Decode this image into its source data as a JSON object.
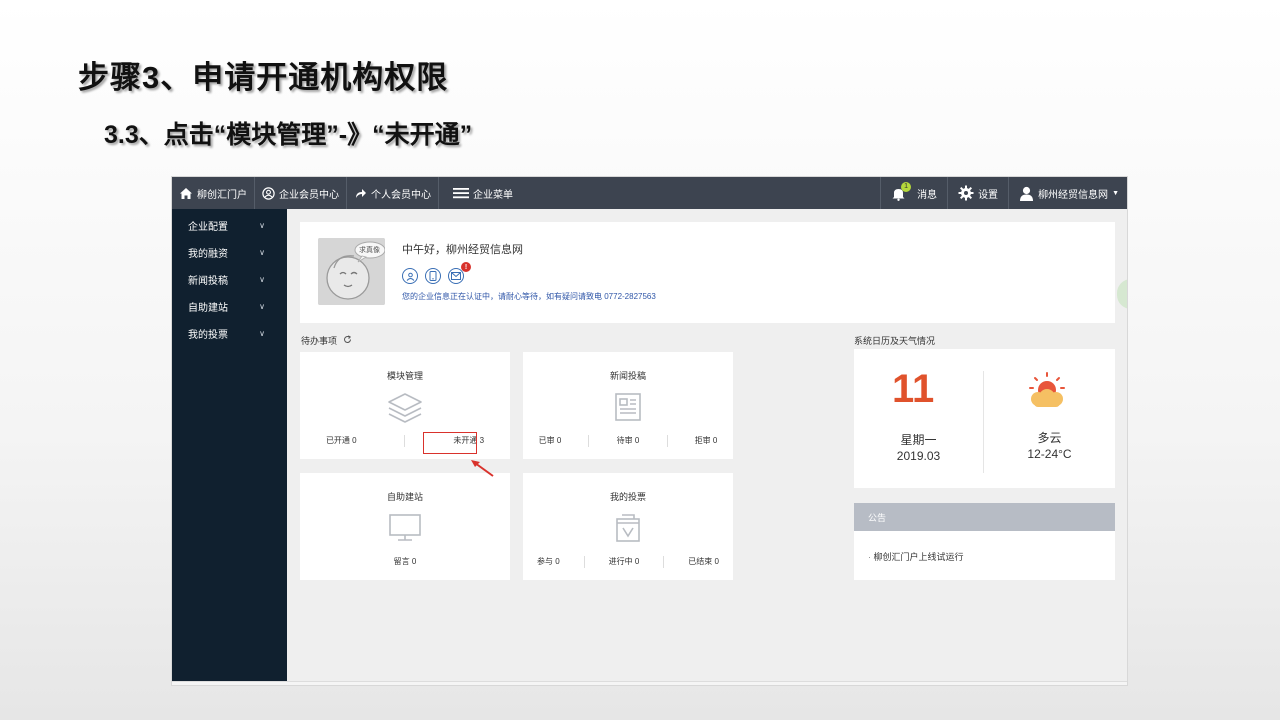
{
  "slide": {
    "title": "步骤3、申请开通机构权限",
    "subtitle": "3.3、点击“模块管理”-》“未开通”"
  },
  "topbar": {
    "home": "柳创汇门户",
    "enterprise_center": "企业会员中心",
    "personal_center": "个人会员中心",
    "enterprise_menu": "企业菜单",
    "messages": "消息",
    "messages_count": "1",
    "settings": "设置",
    "user": "柳州经贸信息网"
  },
  "sidebar": {
    "items": [
      {
        "label": "企业配置"
      },
      {
        "label": "我的融资"
      },
      {
        "label": "新闻投稿"
      },
      {
        "label": "自助建站"
      },
      {
        "label": "我的投票"
      }
    ]
  },
  "profile": {
    "avatar_tag": "求真像",
    "greeting": "中午好，柳州经贸信息网",
    "notice": "您的企业信息正在认证中，请耐心等待，如有疑问请致电 0772-2827563",
    "alert_badge": "!"
  },
  "todo": {
    "label": "待办事项",
    "tiles": [
      {
        "title": "模块管理",
        "stats": [
          "已开通 0",
          "未开通 3"
        ]
      },
      {
        "title": "新闻投稿",
        "stats": [
          "已审 0",
          "待审 0",
          "拒审 0"
        ]
      },
      {
        "title": "自助建站",
        "stats": [
          "留言 0"
        ]
      },
      {
        "title": "我的投票",
        "stats": [
          "参与 0",
          "进行中 0",
          "已结束 0"
        ]
      }
    ]
  },
  "calendar": {
    "label": "系统日历及天气情况",
    "day": "11",
    "weekday": "星期一",
    "year_month": "2019.03",
    "weather": "多云",
    "temperature": "12-24°C"
  },
  "announcement": {
    "label": "公告",
    "items": [
      "柳创汇门户上线试运行"
    ]
  },
  "colors": {
    "topbar": "#3d4450",
    "sidebar": "#10202f",
    "accent_red": "#d9322c",
    "calendar_day": "#e0522c"
  }
}
